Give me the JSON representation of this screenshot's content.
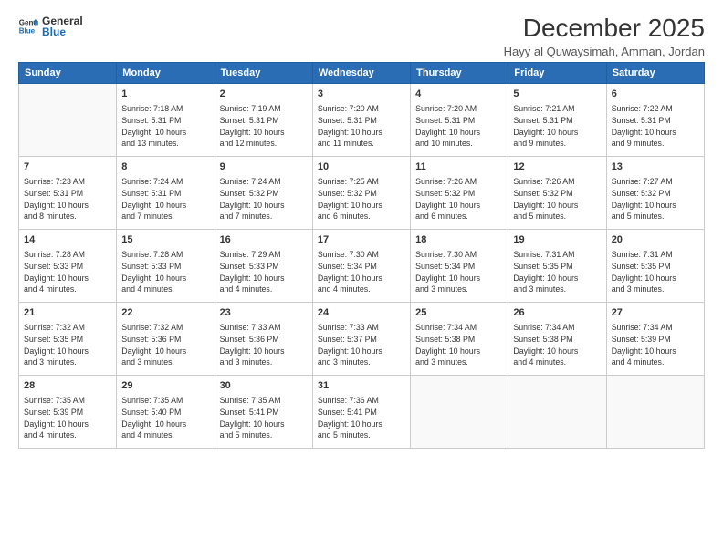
{
  "logo": {
    "line1": "General",
    "line2": "Blue"
  },
  "title": "December 2025",
  "subtitle": "Hayy al Quwaysimah, Amman, Jordan",
  "headers": [
    "Sunday",
    "Monday",
    "Tuesday",
    "Wednesday",
    "Thursday",
    "Friday",
    "Saturday"
  ],
  "weeks": [
    [
      {
        "day": "",
        "info": ""
      },
      {
        "day": "1",
        "info": "Sunrise: 7:18 AM\nSunset: 5:31 PM\nDaylight: 10 hours\nand 13 minutes."
      },
      {
        "day": "2",
        "info": "Sunrise: 7:19 AM\nSunset: 5:31 PM\nDaylight: 10 hours\nand 12 minutes."
      },
      {
        "day": "3",
        "info": "Sunrise: 7:20 AM\nSunset: 5:31 PM\nDaylight: 10 hours\nand 11 minutes."
      },
      {
        "day": "4",
        "info": "Sunrise: 7:20 AM\nSunset: 5:31 PM\nDaylight: 10 hours\nand 10 minutes."
      },
      {
        "day": "5",
        "info": "Sunrise: 7:21 AM\nSunset: 5:31 PM\nDaylight: 10 hours\nand 9 minutes."
      },
      {
        "day": "6",
        "info": "Sunrise: 7:22 AM\nSunset: 5:31 PM\nDaylight: 10 hours\nand 9 minutes."
      }
    ],
    [
      {
        "day": "7",
        "info": "Sunrise: 7:23 AM\nSunset: 5:31 PM\nDaylight: 10 hours\nand 8 minutes."
      },
      {
        "day": "8",
        "info": "Sunrise: 7:24 AM\nSunset: 5:31 PM\nDaylight: 10 hours\nand 7 minutes."
      },
      {
        "day": "9",
        "info": "Sunrise: 7:24 AM\nSunset: 5:32 PM\nDaylight: 10 hours\nand 7 minutes."
      },
      {
        "day": "10",
        "info": "Sunrise: 7:25 AM\nSunset: 5:32 PM\nDaylight: 10 hours\nand 6 minutes."
      },
      {
        "day": "11",
        "info": "Sunrise: 7:26 AM\nSunset: 5:32 PM\nDaylight: 10 hours\nand 6 minutes."
      },
      {
        "day": "12",
        "info": "Sunrise: 7:26 AM\nSunset: 5:32 PM\nDaylight: 10 hours\nand 5 minutes."
      },
      {
        "day": "13",
        "info": "Sunrise: 7:27 AM\nSunset: 5:32 PM\nDaylight: 10 hours\nand 5 minutes."
      }
    ],
    [
      {
        "day": "14",
        "info": "Sunrise: 7:28 AM\nSunset: 5:33 PM\nDaylight: 10 hours\nand 4 minutes."
      },
      {
        "day": "15",
        "info": "Sunrise: 7:28 AM\nSunset: 5:33 PM\nDaylight: 10 hours\nand 4 minutes."
      },
      {
        "day": "16",
        "info": "Sunrise: 7:29 AM\nSunset: 5:33 PM\nDaylight: 10 hours\nand 4 minutes."
      },
      {
        "day": "17",
        "info": "Sunrise: 7:30 AM\nSunset: 5:34 PM\nDaylight: 10 hours\nand 4 minutes."
      },
      {
        "day": "18",
        "info": "Sunrise: 7:30 AM\nSunset: 5:34 PM\nDaylight: 10 hours\nand 3 minutes."
      },
      {
        "day": "19",
        "info": "Sunrise: 7:31 AM\nSunset: 5:35 PM\nDaylight: 10 hours\nand 3 minutes."
      },
      {
        "day": "20",
        "info": "Sunrise: 7:31 AM\nSunset: 5:35 PM\nDaylight: 10 hours\nand 3 minutes."
      }
    ],
    [
      {
        "day": "21",
        "info": "Sunrise: 7:32 AM\nSunset: 5:35 PM\nDaylight: 10 hours\nand 3 minutes."
      },
      {
        "day": "22",
        "info": "Sunrise: 7:32 AM\nSunset: 5:36 PM\nDaylight: 10 hours\nand 3 minutes."
      },
      {
        "day": "23",
        "info": "Sunrise: 7:33 AM\nSunset: 5:36 PM\nDaylight: 10 hours\nand 3 minutes."
      },
      {
        "day": "24",
        "info": "Sunrise: 7:33 AM\nSunset: 5:37 PM\nDaylight: 10 hours\nand 3 minutes."
      },
      {
        "day": "25",
        "info": "Sunrise: 7:34 AM\nSunset: 5:38 PM\nDaylight: 10 hours\nand 3 minutes."
      },
      {
        "day": "26",
        "info": "Sunrise: 7:34 AM\nSunset: 5:38 PM\nDaylight: 10 hours\nand 4 minutes."
      },
      {
        "day": "27",
        "info": "Sunrise: 7:34 AM\nSunset: 5:39 PM\nDaylight: 10 hours\nand 4 minutes."
      }
    ],
    [
      {
        "day": "28",
        "info": "Sunrise: 7:35 AM\nSunset: 5:39 PM\nDaylight: 10 hours\nand 4 minutes."
      },
      {
        "day": "29",
        "info": "Sunrise: 7:35 AM\nSunset: 5:40 PM\nDaylight: 10 hours\nand 4 minutes."
      },
      {
        "day": "30",
        "info": "Sunrise: 7:35 AM\nSunset: 5:41 PM\nDaylight: 10 hours\nand 5 minutes."
      },
      {
        "day": "31",
        "info": "Sunrise: 7:36 AM\nSunset: 5:41 PM\nDaylight: 10 hours\nand 5 minutes."
      },
      {
        "day": "",
        "info": ""
      },
      {
        "day": "",
        "info": ""
      },
      {
        "day": "",
        "info": ""
      }
    ]
  ]
}
